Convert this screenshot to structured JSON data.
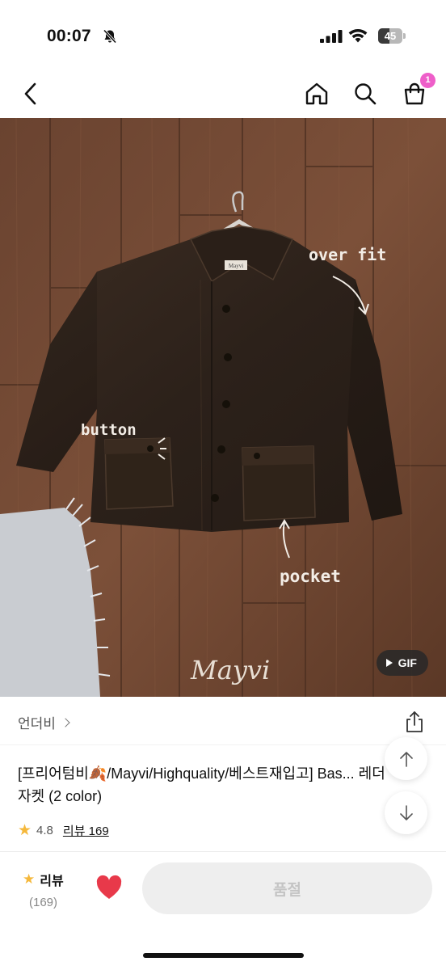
{
  "status_bar": {
    "time": "00:07",
    "battery_level": "45",
    "icons": [
      "bell-slash-icon",
      "cellular-signal-icon",
      "wifi-icon",
      "battery-icon"
    ]
  },
  "nav": {
    "cart_count": "1",
    "icons": [
      "chevron-left-icon",
      "home-icon",
      "search-icon",
      "shopping-bag-icon"
    ]
  },
  "hero": {
    "gif_label": "GIF",
    "annotations": {
      "over_fit": "over fit",
      "button": "button",
      "pocket": "pocket",
      "signature": "Mayvi",
      "tag": "Mayvi"
    }
  },
  "brand": {
    "name": "언더비",
    "icons": [
      "chevron-right-icon",
      "share-icon"
    ]
  },
  "product": {
    "title": "[프리어텀비🍂/Mayvi/Highquality/베스트재입고] Bas... 레더 자켓 (2 color)",
    "rating": "4.8",
    "review_link": "리뷰 169"
  },
  "floating": {
    "icons": [
      "arrow-up-icon",
      "arrow-down-icon"
    ]
  },
  "bottom_bar": {
    "review_label": "리뷰",
    "review_count": "(169)",
    "soldout_label": "품절",
    "heart_color": "#e8394a"
  },
  "colors": {
    "cart_badge": "#ee5ec9",
    "star": "#f5b83b",
    "soldout_bg": "#eeeeee"
  }
}
